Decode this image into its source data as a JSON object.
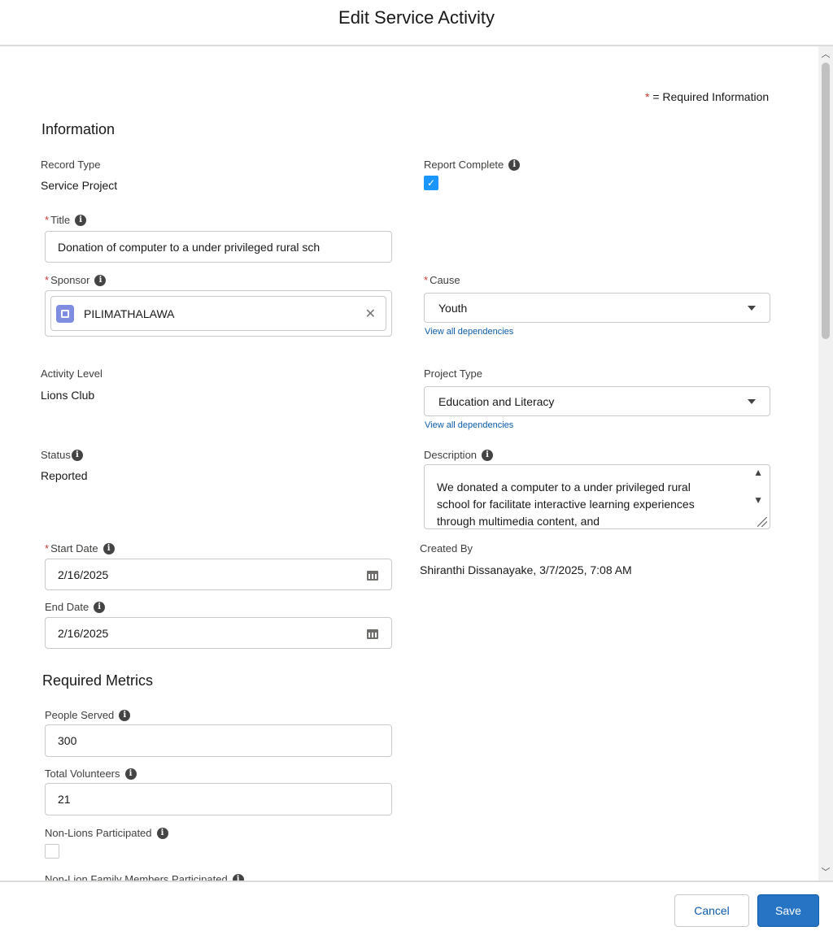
{
  "header": {
    "title": "Edit Service Activity"
  },
  "required_note": {
    "star": "*",
    "text": "= Required Information"
  },
  "sections": {
    "information": "Information",
    "required_metrics": "Required Metrics"
  },
  "fields": {
    "record_type": {
      "label": "Record Type",
      "value": "Service Project"
    },
    "report_complete": {
      "label": "Report Complete",
      "checked": true
    },
    "title": {
      "label": "Title",
      "value": "Donation of computer to a under privileged rural sch"
    },
    "sponsor": {
      "label": "Sponsor",
      "value": "PILIMATHALAWA"
    },
    "cause": {
      "label": "Cause",
      "value": "Youth",
      "dependencies_link": "View all dependencies"
    },
    "activity_level": {
      "label": "Activity Level",
      "value": "Lions Club"
    },
    "project_type": {
      "label": "Project Type",
      "value": "Education and Literacy",
      "dependencies_link": "View all dependencies"
    },
    "status": {
      "label": "Status",
      "value": "Reported"
    },
    "description": {
      "label": "Description",
      "value": "We donated a computer to a under privileged rural school for facilitate interactive learning experiences through multimedia content, and"
    },
    "start_date": {
      "label": "Start Date",
      "value": "2/16/2025"
    },
    "created_by": {
      "label": "Created By",
      "value": "Shiranthi Dissanayake, 3/7/2025, 7:08 AM"
    },
    "end_date": {
      "label": "End Date",
      "value": "2/16/2025"
    },
    "people_served": {
      "label": "People Served",
      "value": "300"
    },
    "total_volunteers": {
      "label": "Total Volunteers",
      "value": "21"
    },
    "non_lions_participated": {
      "label": "Non-Lions Participated",
      "checked": false
    },
    "non_lion_family": {
      "label": "Non-Lion Family Members Participated"
    }
  },
  "footer": {
    "cancel_label": "Cancel",
    "save_label": "Save"
  },
  "colors": {
    "accent": "#2774c4",
    "required": "#c23934",
    "link": "#0b5cab",
    "checkbox": "#1b96ff"
  },
  "icons": {
    "info": "info-icon",
    "calendar": "calendar-icon",
    "account": "account-icon",
    "clear": "close-icon",
    "dropdown": "chevron-down-icon"
  }
}
